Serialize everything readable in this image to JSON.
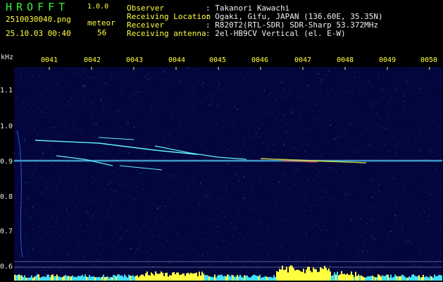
{
  "header": {
    "app_title": "HROFFT",
    "app_version": "1.0.0",
    "file_name": "2510030040.png",
    "timestamp": "25.10.03 00:40",
    "meteor_label": "meteor",
    "meteor_count": "56",
    "info": [
      {
        "key": "Observer",
        "value": ": Takanori Kawachi"
      },
      {
        "key": "Receiving Location",
        "value": ": Ogaki, Gifu, JAPAN (136.60E, 35.35N)"
      },
      {
        "key": "Receiver",
        "value": ": R820T2(RTL-SDR) SDR-Sharp 53.372MHz"
      },
      {
        "key": "Receiving antenna",
        "value": ": 2el-HB9CV Vertical (el. E-W)"
      }
    ]
  },
  "axes": {
    "y_unit": "kHz",
    "y_ticks": [
      "1.1",
      "1.0",
      "0.9",
      "0.8",
      "0.7",
      "0.6"
    ],
    "x_ticks": [
      "0041",
      "0042",
      "0043",
      "0044",
      "0045",
      "0046",
      "0047",
      "0048",
      "0049",
      "0050"
    ]
  },
  "colors": {
    "background": "#000000",
    "spectrogram_bg": "#03063a",
    "signal_cyan": "#40e0ff",
    "signal_yellow": "#ffff40",
    "header_green": "#3cf03c"
  }
}
